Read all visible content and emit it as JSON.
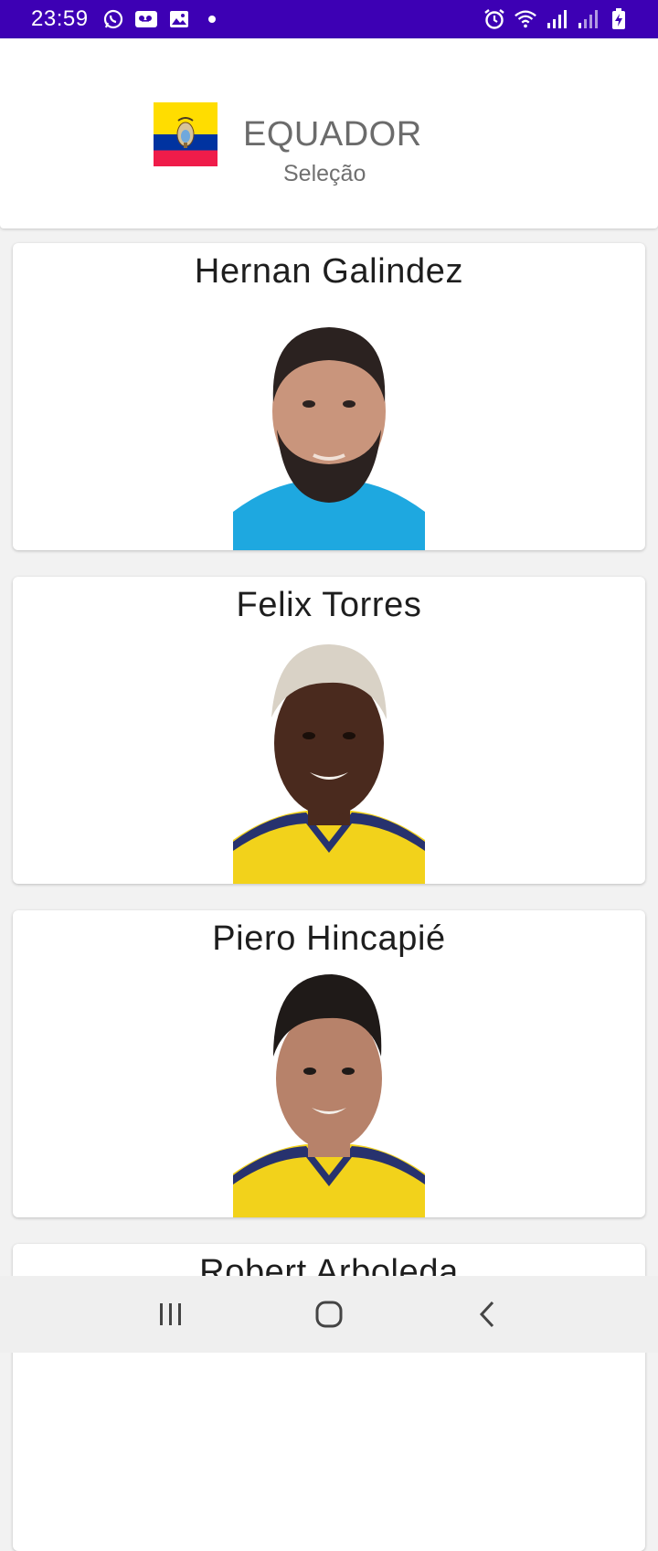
{
  "status_bar": {
    "time": "23:59",
    "left_icons": [
      "whatsapp-icon",
      "voicemail-icon",
      "image-icon",
      "dot-icon"
    ],
    "right_icons": [
      "alarm-icon",
      "wifi-icon",
      "signal-icon",
      "signal-icon-2",
      "battery-charging-icon"
    ],
    "background": "#3d00b4"
  },
  "header": {
    "title": "EQUADOR",
    "subtitle": "Seleção",
    "flag_colors": [
      "#ffdd00",
      "#0033a0",
      "#ef1c4a"
    ]
  },
  "players": [
    {
      "name": "Hernan Galindez",
      "shirt_color": "#1ea8e0",
      "collar_color": "#1ea8e0",
      "hair": "#2b2220",
      "beard": true,
      "skin": "#c9957c"
    },
    {
      "name": "Felix Torres",
      "shirt_color": "#f2d21b",
      "collar_color": "#27326e",
      "hair": "#d9d2c6",
      "beard": false,
      "skin": "#4a2a1e"
    },
    {
      "name": "Piero Hincapié",
      "shirt_color": "#f2d21b",
      "collar_color": "#27326e",
      "hair": "#1f1a18",
      "beard": false,
      "skin": "#b7826a"
    },
    {
      "name": "Robert Arboleda",
      "shirt_color": "#f2d21b",
      "collar_color": "#27326e",
      "hair": "#1f1a18",
      "beard": false,
      "skin": "#5a3526"
    }
  ],
  "nav": {
    "icons": [
      "recent-apps-icon",
      "home-icon",
      "back-icon"
    ]
  }
}
